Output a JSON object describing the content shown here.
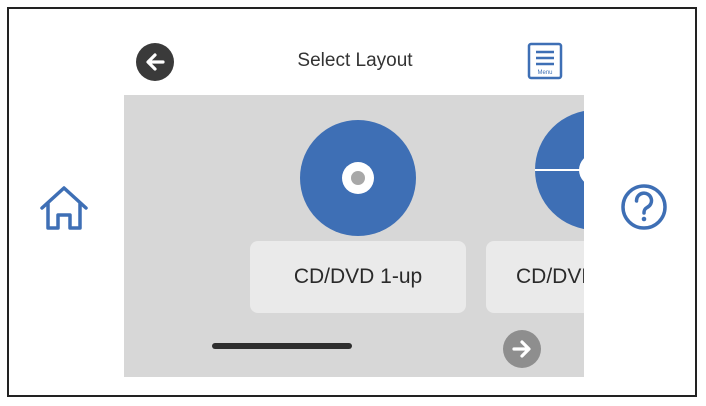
{
  "header": {
    "title": "Select Layout",
    "back_icon": "arrow-left-icon",
    "menu_icon": "menu-icon",
    "menu_caption": "Menu"
  },
  "side": {
    "home_icon": "home-icon",
    "help_icon": "help-icon"
  },
  "layouts": [
    {
      "label": "CD/DVD 1-up",
      "icon": "disc-icon"
    },
    {
      "label": "CD/DVD",
      "icon": "disc-icon"
    }
  ],
  "carousel": {
    "next_icon": "arrow-right-icon"
  },
  "colors": {
    "accent": "#3e6fb5",
    "panel": "#d7d7d7",
    "button": "#eaeaea",
    "dark_icon": "#3a3a3a",
    "disabled_icon": "#8e8e8e"
  }
}
